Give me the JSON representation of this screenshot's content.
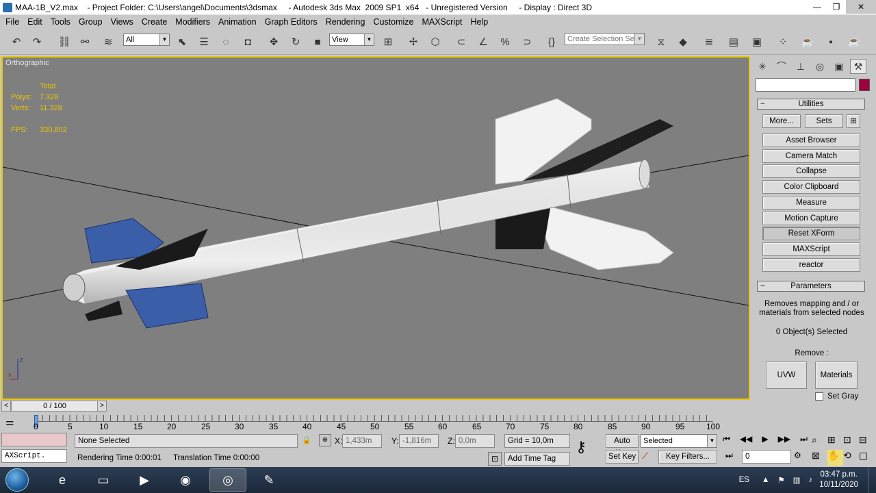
{
  "window": {
    "title": "MAA-1B_V2.max    - Project Folder: C:\\Users\\angel\\Documents\\3dsmax     - Autodesk 3ds Max  2009 SP1  x64   - Unregistered Version     - Display : Direct 3D",
    "minimize": "—",
    "maximize": "❐",
    "close": "✕"
  },
  "menu": [
    "File",
    "Edit",
    "Tools",
    "Group",
    "Views",
    "Create",
    "Modifiers",
    "Animation",
    "Graph Editors",
    "Rendering",
    "Customize",
    "MAXScript",
    "Help"
  ],
  "toolbar": {
    "selection_filter": "All",
    "reference_coord": "View",
    "named_selection_placeholder": "Create Selection Set"
  },
  "viewport": {
    "label": "Orthographic",
    "stats_header": "Total",
    "polys_label": "Polys:",
    "polys_value": "7.328",
    "verts_label": "Verts:",
    "verts_value": "11.328",
    "fps_label": "FPS:",
    "fps_value": "330,852",
    "axis_z": "z",
    "axis_x": "x"
  },
  "command_panel": {
    "utilities_header": "Utilities",
    "more_button": "More...",
    "sets_button": "Sets",
    "utilities": [
      "Asset Browser",
      "Camera Match",
      "Collapse",
      "Color Clipboard",
      "Measure",
      "Motion Capture",
      "Reset XForm",
      "MAXScript",
      "reactor"
    ],
    "parameters_header": "Parameters",
    "description_line1": "Removes mapping and / or",
    "description_line2": "materials from selected nodes",
    "selected_count": "0 Object(s) Selected",
    "remove_label": "Remove :",
    "uvw_button": "UVW",
    "materials_button": "Materials",
    "set_gray_label": "Set Gray",
    "accent_color": "#a00040"
  },
  "timeline": {
    "frame_display": "0 / 100",
    "ticks": [
      "0",
      "5",
      "10",
      "15",
      "20",
      "25",
      "30",
      "35",
      "40",
      "45",
      "50",
      "55",
      "60",
      "65",
      "70",
      "75",
      "80",
      "85",
      "90",
      "95",
      "100"
    ]
  },
  "status": {
    "maxscript_listener": "AXScript.",
    "selection_status": "None Selected",
    "prompt_line": "Rendering Time  0:00:01",
    "translation_time": "Translation Time  0:00:00",
    "x_label": "X:",
    "x_value": "1,433m",
    "y_label": "Y:",
    "y_value": "-1,816m",
    "z_label": "Z:",
    "z_value": "0,0m",
    "grid": "Grid = 10,0m",
    "add_time_tag": "Add Time Tag",
    "auto_key": "Auto Key",
    "set_key": "Set Key",
    "key_mode": "Selected",
    "key_filters": "Key Filters...",
    "current_frame": "0"
  },
  "taskbar": {
    "language": "ES",
    "time": "03:47 p.m.",
    "date": "10/11/2020"
  }
}
